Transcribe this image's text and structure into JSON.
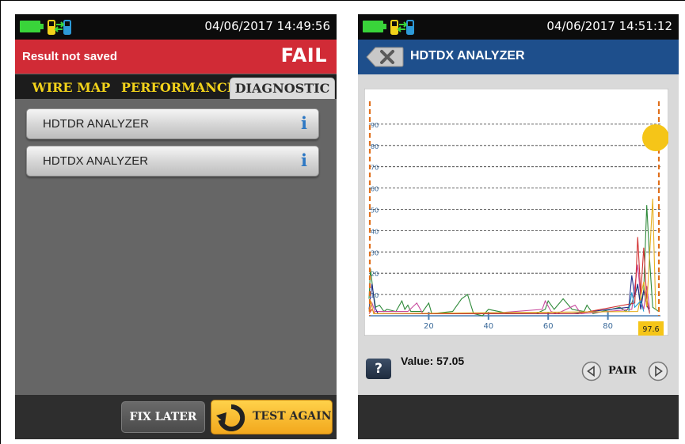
{
  "left": {
    "statusbar": {
      "datetime": "04/06/2017 14:49:56"
    },
    "result": {
      "status": "Result not saved",
      "verdict": "FAIL"
    },
    "tabs": [
      {
        "label": "WIRE MAP",
        "active": false
      },
      {
        "label": "PERFORMANCE",
        "active": false
      },
      {
        "label": "DIAGNOSTIC",
        "active": true
      }
    ],
    "menu": [
      {
        "label": "HDTDR ANALYZER",
        "icon": "info-icon"
      },
      {
        "label": "HDTDX ANALYZER",
        "icon": "info-icon"
      }
    ],
    "buttons": {
      "fix_later": "FIX LATER",
      "test_again": "TEST AGAIN"
    }
  },
  "right": {
    "statusbar": {
      "datetime": "04/06/2017 14:51:12"
    },
    "title": "HDTDX ANALYZER",
    "value_label": "Value: 57.05",
    "help_label": "?",
    "pair_label": "PAIR",
    "cursor_value": "97.6"
  },
  "colors": {
    "fail_red": "#d12b36",
    "title_blue": "#1e4f8c",
    "tab_yellow": "#f2d21a",
    "test_again_orange": "#f2a81d",
    "info_blue": "#2d78c4",
    "cursor_orange": "#e0701c",
    "cursor_marker": "#f5c518"
  },
  "chart_data": {
    "type": "line",
    "title": "",
    "xlabel": "",
    "ylabel": "",
    "xlim": [
      0,
      97.6
    ],
    "ylim": [
      0,
      100
    ],
    "xticks": [
      20,
      40,
      60,
      80
    ],
    "yticks": [
      10,
      20,
      30,
      40,
      50,
      60,
      70,
      80,
      90
    ],
    "grid": true,
    "cursor_x": 97.6,
    "start_marker_x": 0,
    "series": [
      {
        "color": "#2f8a3a",
        "points": [
          [
            0,
            8
          ],
          [
            0.5,
            22
          ],
          [
            1.3,
            12
          ],
          [
            2.2,
            4
          ],
          [
            3.5,
            5
          ],
          [
            5,
            2
          ],
          [
            6,
            3
          ],
          [
            9,
            2
          ],
          [
            11,
            7
          ],
          [
            12,
            3
          ],
          [
            13,
            5
          ],
          [
            14,
            2
          ],
          [
            18,
            2
          ],
          [
            20,
            6
          ],
          [
            21,
            1
          ],
          [
            28,
            2
          ],
          [
            31,
            8
          ],
          [
            33,
            10
          ],
          [
            35,
            1
          ],
          [
            38,
            0
          ],
          [
            40,
            3
          ],
          [
            47,
            1
          ],
          [
            52,
            1
          ],
          [
            56,
            1
          ],
          [
            59,
            3
          ],
          [
            60,
            7
          ],
          [
            62,
            3
          ],
          [
            65,
            8
          ],
          [
            68,
            3
          ],
          [
            72,
            2
          ],
          [
            73,
            5
          ],
          [
            75,
            1
          ],
          [
            78,
            2
          ],
          [
            84,
            4
          ],
          [
            86,
            2
          ],
          [
            88,
            6
          ],
          [
            90,
            14
          ],
          [
            91,
            6
          ],
          [
            92,
            12
          ],
          [
            93,
            52
          ],
          [
            94,
            26
          ],
          [
            95,
            4
          ],
          [
            97,
            2
          ]
        ]
      },
      {
        "color": "#c84b9e",
        "points": [
          [
            0,
            2
          ],
          [
            1,
            6
          ],
          [
            2,
            2
          ],
          [
            13,
            2
          ],
          [
            16,
            6
          ],
          [
            18,
            1
          ],
          [
            40,
            1
          ],
          [
            58,
            3
          ],
          [
            59,
            7
          ],
          [
            61,
            2
          ],
          [
            63,
            1
          ],
          [
            69,
            5
          ],
          [
            71,
            1
          ],
          [
            88,
            3
          ],
          [
            90,
            24
          ],
          [
            91,
            8
          ],
          [
            92,
            3
          ],
          [
            93,
            14
          ],
          [
            94,
            3
          ]
        ]
      },
      {
        "color": "#222c8a",
        "points": [
          [
            0,
            3
          ],
          [
            1,
            15
          ],
          [
            2,
            4
          ],
          [
            3,
            1
          ],
          [
            30,
            1
          ],
          [
            50,
            1
          ],
          [
            68,
            1
          ],
          [
            87,
            4
          ],
          [
            88,
            19
          ],
          [
            89,
            9
          ],
          [
            90,
            15
          ],
          [
            91,
            3
          ],
          [
            92,
            12
          ],
          [
            93,
            5
          ],
          [
            94,
            2
          ]
        ]
      },
      {
        "color": "#d23232",
        "points": [
          [
            0,
            1
          ],
          [
            1,
            3
          ],
          [
            2,
            1
          ],
          [
            40,
            1
          ],
          [
            70,
            1
          ],
          [
            89,
            6
          ],
          [
            90,
            37
          ],
          [
            91,
            10
          ],
          [
            92,
            32
          ],
          [
            93,
            8
          ],
          [
            94,
            1
          ]
        ]
      },
      {
        "color": "#e6b020",
        "points": [
          [
            0,
            2
          ],
          [
            0.6,
            7
          ],
          [
            1.5,
            1
          ],
          [
            90,
            2
          ],
          [
            92,
            16
          ],
          [
            93,
            4
          ],
          [
            95,
            55
          ],
          [
            96,
            3
          ]
        ]
      },
      {
        "color": "#1e9ad0",
        "points": [
          [
            87,
            2
          ],
          [
            88,
            11
          ],
          [
            89,
            4
          ],
          [
            91,
            7
          ],
          [
            92,
            2
          ]
        ]
      }
    ]
  }
}
